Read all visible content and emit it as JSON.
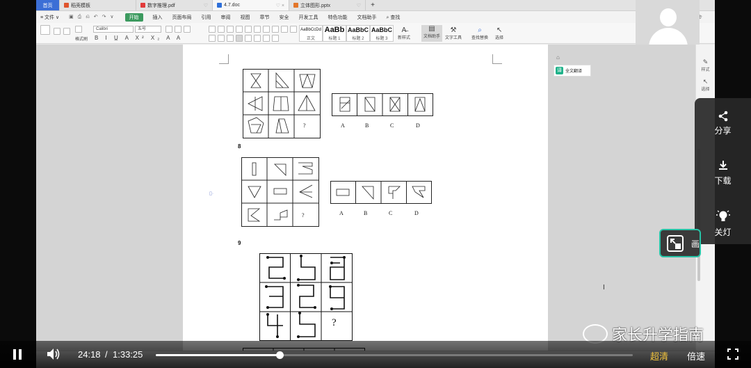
{
  "app": {
    "tabs": [
      {
        "label": "首页"
      },
      {
        "label": "稻壳模板"
      },
      {
        "label": "数字推理.pdf"
      },
      {
        "label": "4.7.doc"
      },
      {
        "label": "立体图形.pptx"
      }
    ],
    "menu": [
      {
        "label": "≡ 文件 ∨"
      },
      {
        "label": "开始"
      },
      {
        "label": "插入"
      },
      {
        "label": "页面布局"
      },
      {
        "label": "引用"
      },
      {
        "label": "审阅"
      },
      {
        "label": "视图"
      },
      {
        "label": "章节"
      },
      {
        "label": "安全"
      },
      {
        "label": "开发工具"
      },
      {
        "label": "特色功能"
      },
      {
        "label": "文档助手"
      },
      {
        "label": "查找"
      }
    ],
    "cloud_label": "未同步",
    "ribbon": {
      "font_name": "Calibri",
      "font_size": "五号",
      "format_painter": "格式刷",
      "styles": [
        {
          "sample": "AaBbCcDd",
          "name": "正文"
        },
        {
          "sample": "AaBb",
          "name": "标题 1"
        },
        {
          "sample": "AaBbC",
          "name": "标题 2"
        },
        {
          "sample": "AaBbC",
          "name": "标题 3"
        }
      ],
      "new_style": "新样式",
      "doc_helper": "文档助手",
      "text_tools": "文字工具",
      "find_replace": "查找替换",
      "select": "选择"
    },
    "full_translate": "全文翻译",
    "side_panel": [
      "样式",
      "选择"
    ]
  },
  "doc": {
    "q8": "8",
    "q9": "9",
    "options": [
      "A",
      "B",
      "C",
      "D"
    ],
    "question_mark": "?"
  },
  "player": {
    "menu": [
      {
        "label": "分享",
        "icon": "share-icon"
      },
      {
        "label": "下载",
        "icon": "download-icon"
      },
      {
        "label": "关灯",
        "icon": "bulb-icon"
      }
    ],
    "pip_label": "画",
    "watermark": "家长升学指南",
    "current_time": "24:18",
    "separator": "/",
    "duration": "1:33:25",
    "progress": 0.26,
    "quality": "超清",
    "speed": "倍速"
  }
}
